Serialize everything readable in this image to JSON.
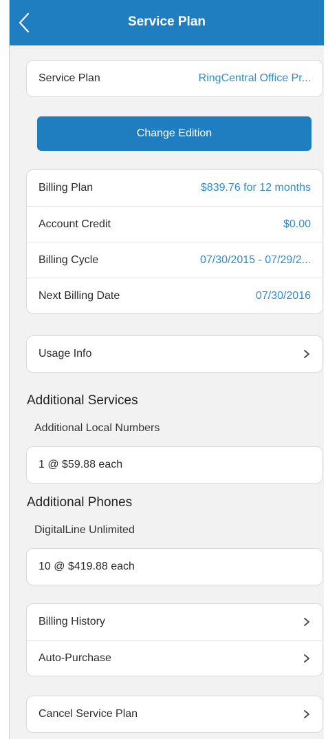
{
  "header": {
    "title": "Service Plan",
    "back_icon": "chevron-left-icon"
  },
  "plan": {
    "label": "Service Plan",
    "value": "RingCentral Office Pr..."
  },
  "change_edition_label": "Change Edition",
  "billing": [
    {
      "label": "Billing Plan",
      "value": "$839.76 for 12 months"
    },
    {
      "label": "Account Credit",
      "value": "$0.00"
    },
    {
      "label": "Billing Cycle",
      "value": "07/30/2015 - 07/29/2..."
    },
    {
      "label": "Next Billing Date",
      "value": "07/30/2016"
    }
  ],
  "usage_info_label": "Usage Info",
  "additional_services": {
    "title": "Additional Services",
    "subtitle": "Additional Local Numbers",
    "value": "1 @ $59.88 each"
  },
  "additional_phones": {
    "title": "Additional Phones",
    "subtitle": "DigitalLine Unlimited",
    "value": "10 @ $419.88 each"
  },
  "history": {
    "billing_history": "Billing History",
    "auto_purchase": "Auto-Purchase"
  },
  "cancel_label": "Cancel Service Plan",
  "colors": {
    "accent": "#1f7ec0",
    "value_text": "#2f8ccc",
    "background": "#f2f2f2"
  }
}
